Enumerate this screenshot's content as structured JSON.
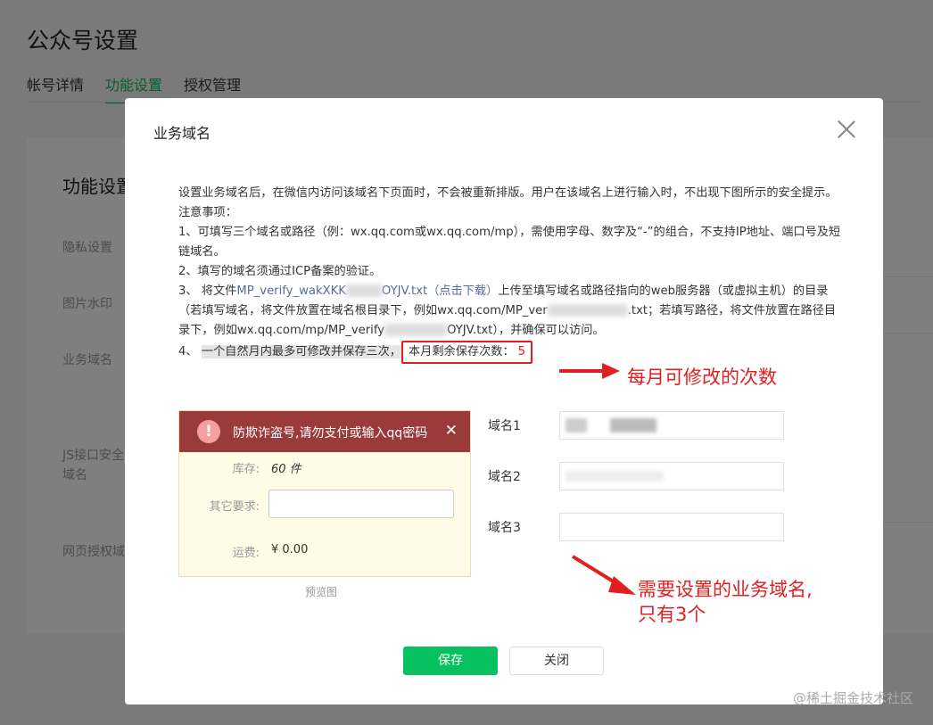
{
  "page": {
    "title": "公众号设置",
    "tabs": [
      "帐号详情",
      "功能设置",
      "授权管理"
    ],
    "card_title": "功能设置",
    "rows": [
      "隐私设置",
      "图片水印",
      "业务域名",
      "JS接口安全域名",
      "网页授权域"
    ]
  },
  "dialog": {
    "title": "业务域名",
    "desc_line1": "设置业务域名后，在微信内访问该域名下页面时，不会被重新排版。用户在该域名上进行输入时，不出现下图所示的安全提示。",
    "notes_title": "注意事项：",
    "note1": "1、可填写三个域名或路径（例：wx.qq.com或wx.qq.com/mp），需使用字母、数字及“-”的组合，不支持IP地址、端口号及短链域名。",
    "note2": "2、填写的域名须通过ICP备案的验证。",
    "note3_a": "3、 将文件",
    "note3_file": "MP_verify_wakXKK",
    "note3_file_end": "OYJV.txt",
    "note3_download": "（点击下载）",
    "note3_b": "上传至填写域名或路径指向的web服务器（或虚拟主机）的目录（若填写域名，将文件放置在域名根目录下，例如wx.qq.com/MP_ver",
    "note3_c": ".txt；若填写路径，将文件放置在路径目录下，例如wx.qq.com/mp/MP_verify",
    "note3_d": "OYJV.txt），并确保可以访问。",
    "note4_prefix": "4、",
    "note4_highlight": "一个自然月内最多可修改并保存三次，",
    "remaining_label": "本月剩余保存次数：",
    "remaining_count": "5",
    "annotation_monthly": "每月可修改的次数",
    "preview": {
      "warning": "防欺诈盗号,请勿支付或输入qq密码",
      "close_glyph": "✕",
      "alert_glyph": "!",
      "stock_label": "库存:",
      "stock_value": "60 件",
      "other_label": "其它要求:",
      "shipping_label": "运费:",
      "shipping_value": "¥ 0.00",
      "caption": "预览图"
    },
    "domains": [
      {
        "label": "域名1"
      },
      {
        "label": "域名2"
      },
      {
        "label": "域名3"
      }
    ],
    "annotation_domains_1": "需要设置的业务域名,",
    "annotation_domains_2": "只有3个",
    "save_label": "保存",
    "close_label": "关闭"
  },
  "watermark": "@稀土掘金技术社区",
  "colors": {
    "accent_green": "#07c160",
    "annotation_red": "#e02020",
    "link_blue": "#576b95",
    "warning_bar": "#9b3a3a"
  }
}
